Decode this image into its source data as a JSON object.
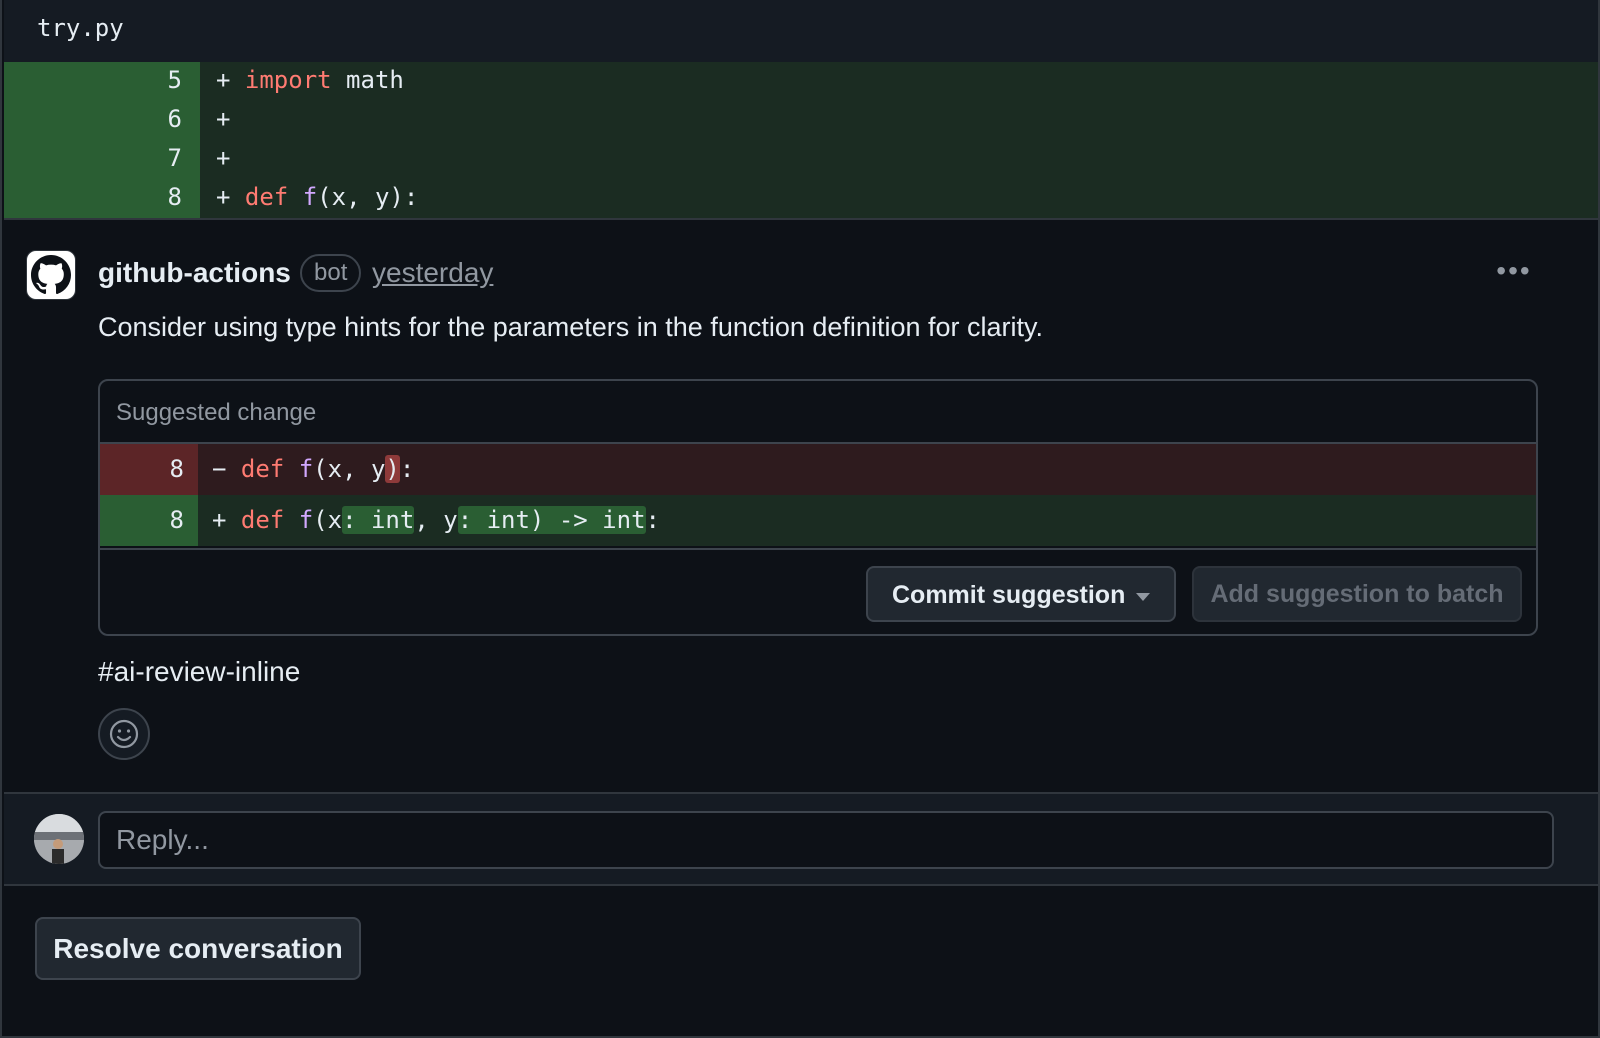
{
  "file": {
    "name": "try.py"
  },
  "diff": {
    "lines": [
      {
        "num": "5",
        "sign": "+ ",
        "tokens": [
          [
            "kw",
            "import"
          ],
          [
            "",
            " math"
          ]
        ]
      },
      {
        "num": "6",
        "sign": "+",
        "tokens": []
      },
      {
        "num": "7",
        "sign": "+",
        "tokens": []
      },
      {
        "num": "8",
        "sign": "+ ",
        "tokens": [
          [
            "kw",
            "def"
          ],
          [
            "",
            " "
          ],
          [
            "fn",
            "f"
          ],
          [
            "",
            "(x, y):"
          ]
        ]
      }
    ]
  },
  "comment": {
    "author": "github-actions",
    "badge": "bot",
    "timestamp": "yesterday",
    "more_label": "•••",
    "body": "Consider using type hints for the parameters in the function definition for clarity.",
    "tag": "#ai-review-inline"
  },
  "suggestion": {
    "title": "Suggested change",
    "removed": {
      "num": "8",
      "sign": "− ",
      "tokens": [
        [
          "kw",
          "def"
        ],
        [
          "",
          " "
        ],
        [
          "fn",
          "f"
        ],
        [
          "",
          "(x, y"
        ],
        [
          "hl-del",
          ")"
        ],
        [
          "",
          ":"
        ]
      ]
    },
    "added": {
      "num": "8",
      "sign": "+ ",
      "tokens": [
        [
          "kw",
          "def"
        ],
        [
          "",
          " "
        ],
        [
          "fn",
          "f"
        ],
        [
          "",
          "(x"
        ],
        [
          "hl-add",
          ": int"
        ],
        [
          "",
          ", y"
        ],
        [
          "hl-add",
          ": int) -> int"
        ],
        [
          "",
          ":"
        ]
      ]
    },
    "commit_label": "Commit suggestion",
    "batch_label": "Add suggestion to batch"
  },
  "reply": {
    "placeholder": "Reply..."
  },
  "resolve_label": "Resolve conversation"
}
